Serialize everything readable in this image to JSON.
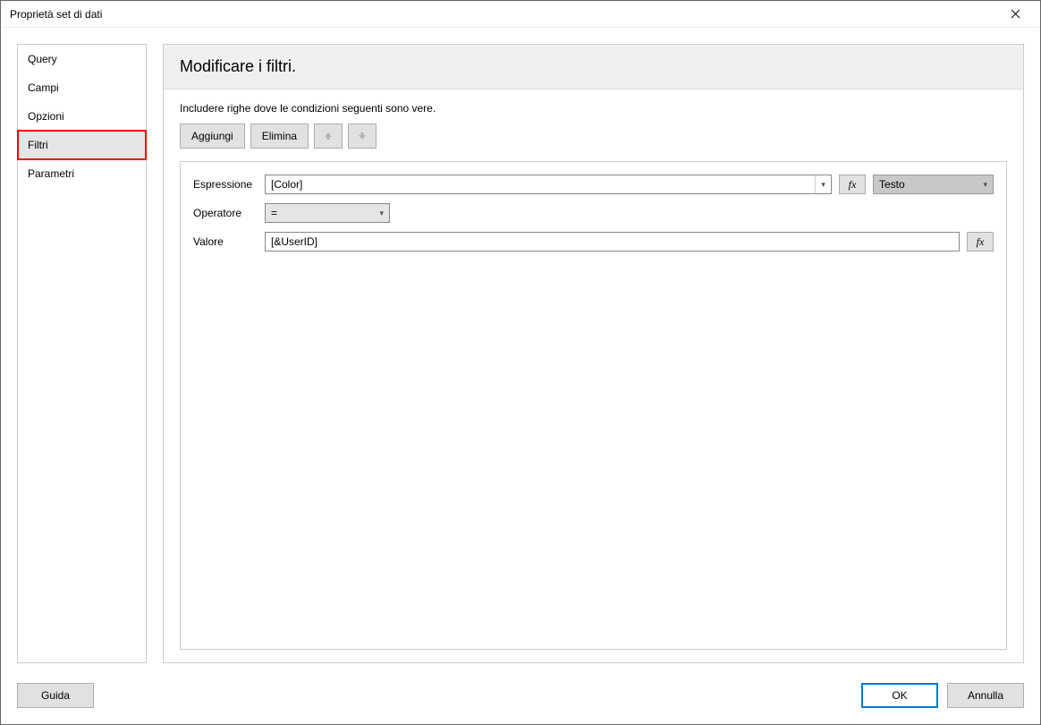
{
  "window": {
    "title": "Proprietà set di dati"
  },
  "sidebar": {
    "items": [
      {
        "label": "Query"
      },
      {
        "label": "Campi"
      },
      {
        "label": "Opzioni"
      },
      {
        "label": "Filtri"
      },
      {
        "label": "Parametri"
      }
    ]
  },
  "main": {
    "header_title": "Modificare i filtri.",
    "instruction": "Includere righe dove le condizioni seguenti sono vere.",
    "toolbar": {
      "add_label": "Aggiungi",
      "delete_label": "Elimina"
    },
    "form": {
      "expression_label": "Espressione",
      "expression_value": "[Color]",
      "type_value": "Testo",
      "operator_label": "Operatore",
      "operator_value": "=",
      "value_label": "Valore",
      "value_value": "[&UserID]",
      "fx_label": "fx"
    }
  },
  "footer": {
    "help_label": "Guida",
    "ok_label": "OK",
    "cancel_label": "Annulla"
  }
}
